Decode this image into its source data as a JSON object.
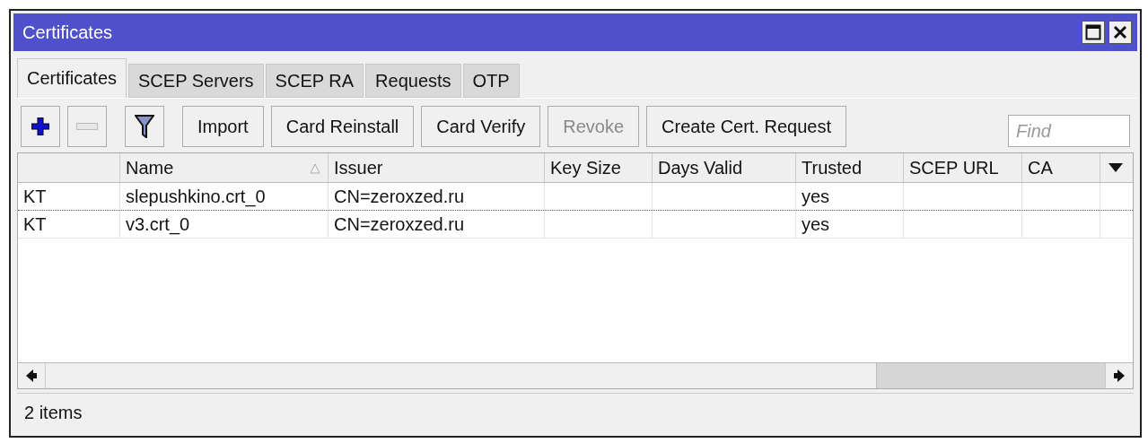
{
  "window": {
    "title": "Certificates"
  },
  "tabs": [
    {
      "label": "Certificates",
      "selected": true
    },
    {
      "label": "SCEP Servers",
      "selected": false
    },
    {
      "label": "SCEP RA",
      "selected": false
    },
    {
      "label": "Requests",
      "selected": false
    },
    {
      "label": "OTP",
      "selected": false
    }
  ],
  "toolbar": {
    "buttons": [
      {
        "kind": "add",
        "disabled": false
      },
      {
        "kind": "remove",
        "disabled": true
      },
      {
        "kind": "filter",
        "disabled": false
      },
      {
        "kind": "text",
        "label": "Import",
        "disabled": false
      },
      {
        "kind": "text",
        "label": "Card Reinstall",
        "disabled": false
      },
      {
        "kind": "text",
        "label": "Card Verify",
        "disabled": false
      },
      {
        "kind": "text",
        "label": "Revoke",
        "disabled": true
      },
      {
        "kind": "text",
        "label": "Create Cert. Request",
        "disabled": false
      }
    ],
    "find": {
      "placeholder": "Find"
    }
  },
  "table": {
    "columns": [
      {
        "sorted": false
      },
      {
        "label": "Name",
        "sorted": true
      },
      {
        "label": "Issuer",
        "sorted": false
      },
      {
        "label": "Key Size",
        "sorted": false
      },
      {
        "label": "Days Valid",
        "sorted": false
      },
      {
        "label": "Trusted",
        "sorted": false
      },
      {
        "label": "SCEP URL",
        "sorted": false
      },
      {
        "label": "CA",
        "sorted": false
      }
    ],
    "rows": [
      {
        "cells": [
          "KT",
          "slepushkino.crt_0",
          "CN=zeroxzed.ru",
          null,
          null,
          "yes",
          null,
          null
        ]
      },
      {
        "cells": [
          "KT",
          "v3.crt_0",
          "CN=zeroxzed.ru",
          null,
          null,
          "yes",
          null,
          null
        ]
      }
    ]
  },
  "status_bar": {
    "count": "2 items"
  }
}
